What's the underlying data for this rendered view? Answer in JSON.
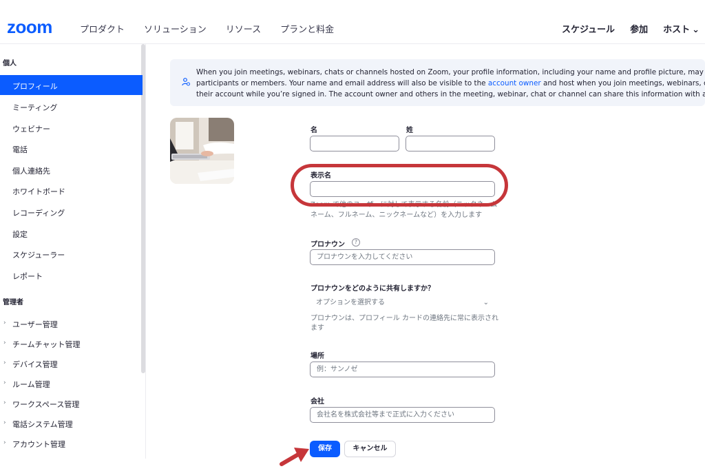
{
  "header": {
    "logo": "zoom",
    "nav": [
      "プロダクト",
      "ソリューション",
      "リソース",
      "プランと料金"
    ],
    "right": {
      "schedule": "スケジュール",
      "join": "参加",
      "host": "ホスト"
    }
  },
  "sidebar": {
    "personal_title": "個人",
    "personal_items": [
      "プロフィール",
      "ミーティング",
      "ウェビナー",
      "電話",
      "個人連絡先",
      "ホワイトボード",
      "レコーディング",
      "設定",
      "スケジューラー",
      "レポート"
    ],
    "admin_title": "管理者",
    "admin_items": [
      "ユーザー管理",
      "チームチャット管理",
      "デバイス管理",
      "ルーム管理",
      "ワークスペース管理",
      "電話システム管理",
      "アカウント管理"
    ]
  },
  "banner": {
    "line1": "When you join meetings, webinars, chats or channels hosted on Zoom, your profile information, including your name and profile picture, may be visible to ot",
    "line2_a": "participants or members. Your name and email address will also be visible to the ",
    "line2_link": "account owner",
    "line2_b": " and host when you join meetings, webinars, chats or channe",
    "line3": "their account while you’re signed in. The account owner and others in the meeting, webinar, chat or channel can share this information with apps and others"
  },
  "form": {
    "first_name_label": "名",
    "last_name_label": "姓",
    "first_name_value": "",
    "last_name_value": "",
    "display_name_label": "表示名",
    "display_name_value": "",
    "display_name_hint_1": "Zoom で他のユーザーに対して表示する名前（ニックネーム",
    "display_name_hint_2": "ネーム、フルネーム、ニックネームなど）を入力します",
    "pronoun_label": "プロナウン",
    "pronoun_placeholder": "プロナウンを入力してください",
    "pronoun_share_label": "プロナウンをどのように共有しますか？",
    "pronoun_share_selected": "オプションを選択する",
    "pronoun_share_hint_1": "プロナウンは、プロフィール カードの連絡先に常に表示され",
    "pronoun_share_hint_2": "ます",
    "location_label": "場所",
    "location_placeholder": "例：サンノゼ",
    "company_label": "会社",
    "company_placeholder": "会社名を株式会社等まで正式に入力ください",
    "save_label": "保存",
    "cancel_label": "キャンセル"
  },
  "colors": {
    "accent": "#0b5cff",
    "annotation": "#c6363a"
  },
  "icons": {
    "help": "question-circle-icon",
    "info": "user-info-icon",
    "select": "chevron-down-icon"
  }
}
